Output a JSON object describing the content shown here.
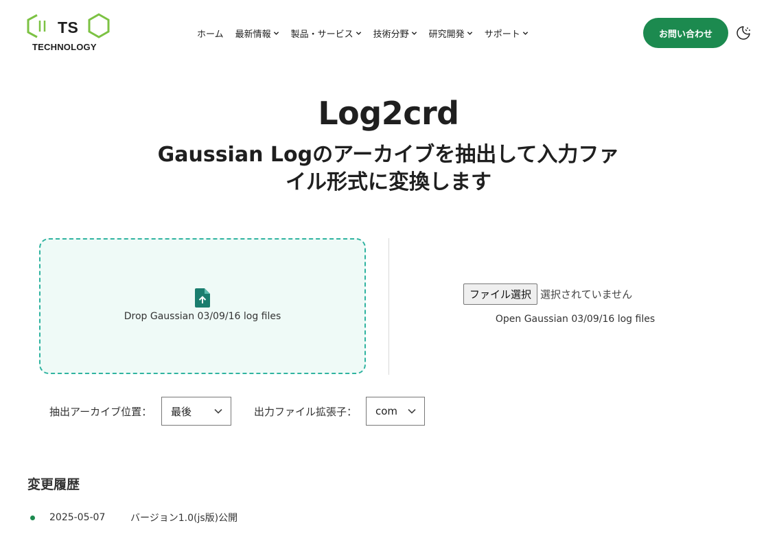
{
  "header": {
    "logo": {
      "ts": "TS",
      "tech": "TECHNOLOGY",
      "accent": "#7cc243"
    },
    "nav": [
      {
        "label": "ホーム",
        "has_dropdown": false
      },
      {
        "label": "最新情報",
        "has_dropdown": true
      },
      {
        "label": "製品・サービス",
        "has_dropdown": true
      },
      {
        "label": "技術分野",
        "has_dropdown": true
      },
      {
        "label": "研究開発",
        "has_dropdown": true
      },
      {
        "label": "サポート",
        "has_dropdown": true
      }
    ],
    "contact_label": "お問い合わせ",
    "theme_icon": "moon-sun-icon"
  },
  "main": {
    "title": "Log2crd",
    "subtitle": "Gaussian Logのアーカイブを抽出して入力ファイル形式に変換します",
    "dropzone": {
      "text": "Drop Gaussian 03/09/16 log files",
      "icon": "file-upload-icon"
    },
    "file_picker": {
      "button": "ファイル選択",
      "status": "選択されていません",
      "caption": "Open Gaussian 03/09/16 log files"
    },
    "options": {
      "archive_label": "抽出アーカイブ位置：",
      "archive_value": "最後",
      "ext_label": "出力ファイル拡張子：",
      "ext_value": "com"
    }
  },
  "history": {
    "title": "変更履歴",
    "items": [
      {
        "date": "2025-05-07",
        "text": "バージョン1.0(js版)公開"
      }
    ]
  },
  "colors": {
    "brand": "#1c8a4f",
    "dropzone_border": "#2fb3a0",
    "dropzone_bg": "#effaf7"
  }
}
